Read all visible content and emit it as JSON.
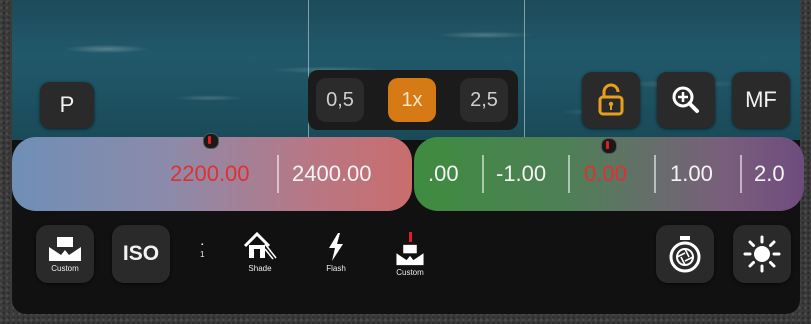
{
  "mode": {
    "label": "P"
  },
  "zoom": {
    "options": [
      "0,5",
      "1x",
      "2,5"
    ],
    "active": "1x"
  },
  "focus_mode": {
    "label": "MF"
  },
  "white_balance_scale": {
    "values": [
      "2200.00",
      "2400.00"
    ],
    "current": "2200.00"
  },
  "exposure_scale": {
    "values": [
      ".00",
      "-1.00",
      "0.00",
      "1.00",
      "2.0"
    ],
    "current": "0.00"
  },
  "bottom_bar": {
    "wb_button_label": "Custom",
    "iso_label": "ISO",
    "presets": [
      {
        "label": "1",
        "icon": "tiny-marker"
      },
      {
        "label": "Shade",
        "icon": "shade-icon"
      },
      {
        "label": "Flash",
        "icon": "flash-icon"
      },
      {
        "label": "Custom",
        "icon": "custom-wb-icon"
      }
    ]
  },
  "colors": {
    "accent_orange": "#d57a14",
    "value_red": "#e03030",
    "lock_yellow": "#e8a01c"
  }
}
